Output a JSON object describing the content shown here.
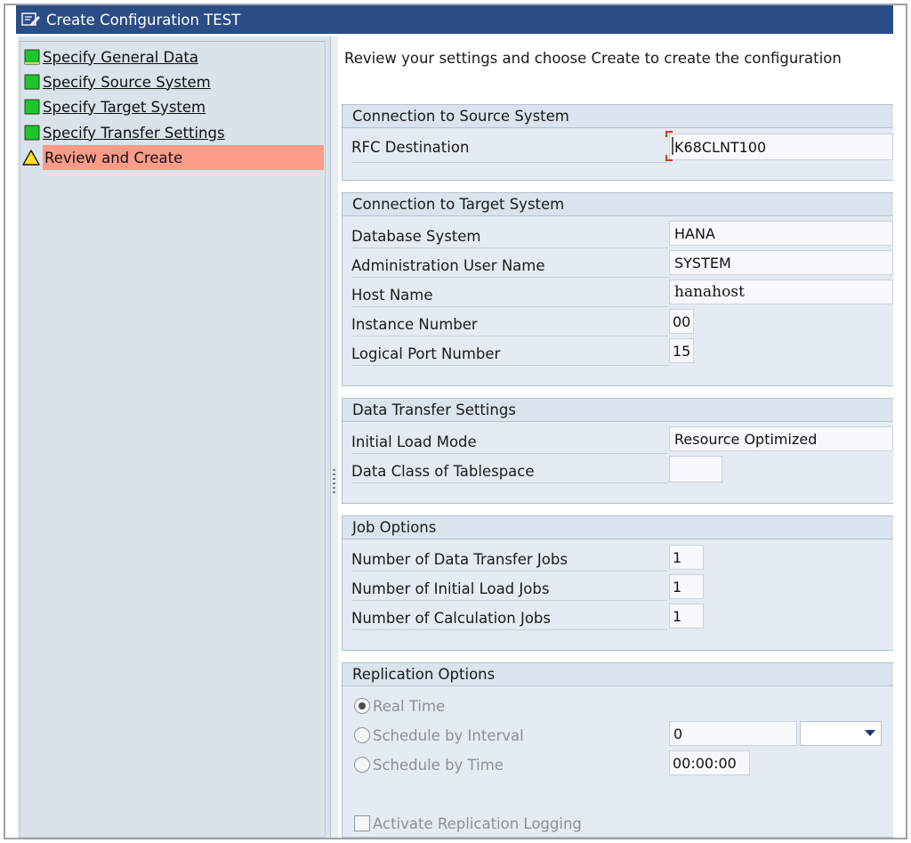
{
  "window": {
    "title": "Create Configuration TEST",
    "title_icon": "edit-window-icon"
  },
  "steps": [
    {
      "label": "Specify General Data",
      "status": "done",
      "status_icon": "green-status-icon"
    },
    {
      "label": "Specify Source System",
      "status": "done",
      "status_icon": "green-status-icon"
    },
    {
      "label": "Specify Target System",
      "status": "done",
      "status_icon": "green-status-icon"
    },
    {
      "label": "Specify Transfer Settings",
      "status": "done",
      "status_icon": "green-status-icon"
    },
    {
      "label": "Review and Create",
      "status": "warning",
      "status_icon": "warning-triangle-icon",
      "active": true
    }
  ],
  "intro": "Review your settings and choose Create to create the configuration",
  "source": {
    "title": "Connection to Source System",
    "rfc_label": "RFC Destination",
    "rfc_value": "K68CLNT100"
  },
  "target": {
    "title": "Connection to Target System",
    "db_label": "Database System",
    "db_value": "HANA",
    "admin_label": "Administration User Name",
    "admin_value": "SYSTEM",
    "host_label": "Host Name",
    "host_value": "hanahost",
    "instance_label": "Instance Number",
    "instance_value": "00",
    "port_label": "Logical Port Number",
    "port_value": "15"
  },
  "transfer": {
    "title": "Data Transfer Settings",
    "mode_label": "Initial Load Mode",
    "mode_value": "Resource Optimized",
    "class_label": "Data Class of Tablespace",
    "class_value": ""
  },
  "jobs": {
    "title": "Job Options",
    "transfer_label": "Number of Data Transfer Jobs",
    "transfer_value": "1",
    "initial_label": "Number of Initial Load Jobs",
    "initial_value": "1",
    "calc_label": "Number of Calculation Jobs",
    "calc_value": "1"
  },
  "replication": {
    "title": "Replication Options",
    "realtime_label": "Real Time",
    "interval_label": "Schedule by Interval",
    "interval_value": "0",
    "interval_unit": "",
    "time_label": "Schedule by Time",
    "time_value": "00:00:00",
    "logging_label": "Activate Replication Logging",
    "selected": "Real Time"
  },
  "colors": {
    "title_bar": "#2b4d86",
    "active_step": "#fc9b88",
    "status_green": "#22c32e",
    "warning_yellow": "#ffe21a"
  }
}
